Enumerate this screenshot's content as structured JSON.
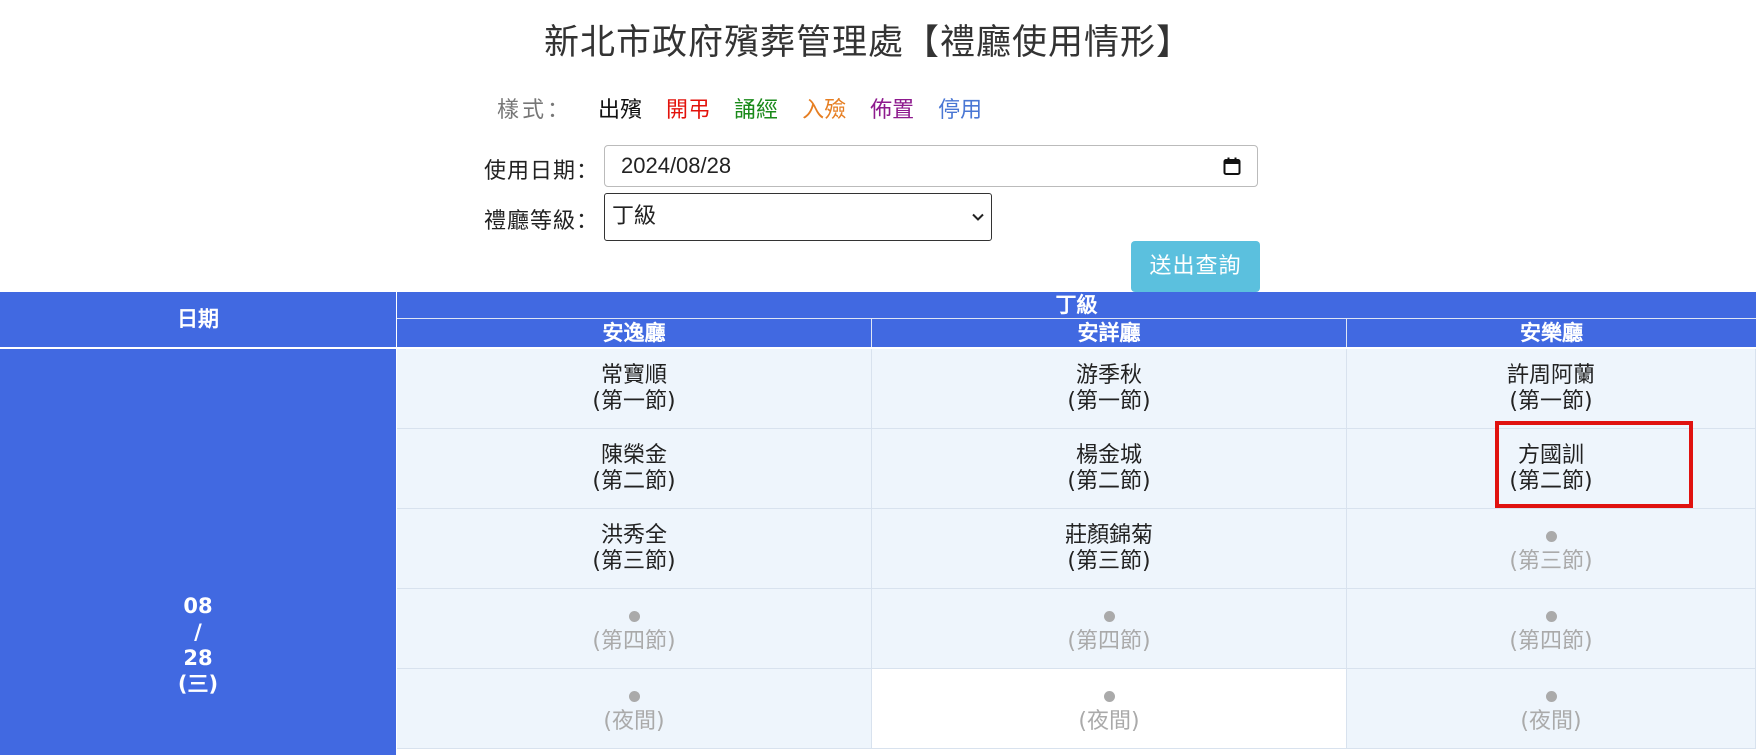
{
  "title": "新北市政府殯葬管理處【禮廳使用情形】",
  "legend": {
    "label": "樣式：",
    "items": [
      {
        "text": "出殯",
        "color": "#111111"
      },
      {
        "text": "開弔",
        "color": "#e3120b"
      },
      {
        "text": "誦經",
        "color": "#1a8a1a"
      },
      {
        "text": "入殮",
        "color": "#e67e22"
      },
      {
        "text": "佈置",
        "color": "#8e1a8e"
      },
      {
        "text": "停用",
        "color": "#4a77d4"
      }
    ]
  },
  "form": {
    "date_label": "使用日期：",
    "date_value": "2024/08/28",
    "level_label": "禮廳等級：",
    "level_value": "丁級",
    "submit_label": "送出查詢"
  },
  "table": {
    "date_header": "日期",
    "level_header": "丁級",
    "halls": [
      "安逸廳",
      "安詳廳",
      "安樂廳"
    ],
    "date_cell": {
      "month": "08",
      "sep": "/",
      "day": "28",
      "weekday": "(三)"
    },
    "rows": [
      [
        {
          "name": "常寶順",
          "session": "(第一節)"
        },
        {
          "name": "游季秋",
          "session": "(第一節)"
        },
        {
          "name": "許周阿蘭",
          "session": "(第一節)"
        }
      ],
      [
        {
          "name": "陳榮金",
          "session": "(第二節)"
        },
        {
          "name": "楊金城",
          "session": "(第二節)"
        },
        {
          "name": "方國訓",
          "session": "(第二節)"
        }
      ],
      [
        {
          "name": "洪秀全",
          "session": "(第三節)"
        },
        {
          "name": "莊顏錦菊",
          "session": "(第三節)"
        },
        {
          "name": "",
          "session": "(第三節)"
        }
      ],
      [
        {
          "name": "",
          "session": "(第四節)"
        },
        {
          "name": "",
          "session": "(第四節)"
        },
        {
          "name": "",
          "session": "(第四節)"
        }
      ],
      [
        {
          "name": "",
          "session": "(夜間)"
        },
        {
          "name": "",
          "session": "(夜間)"
        },
        {
          "name": "",
          "session": "(夜間)"
        }
      ]
    ]
  }
}
